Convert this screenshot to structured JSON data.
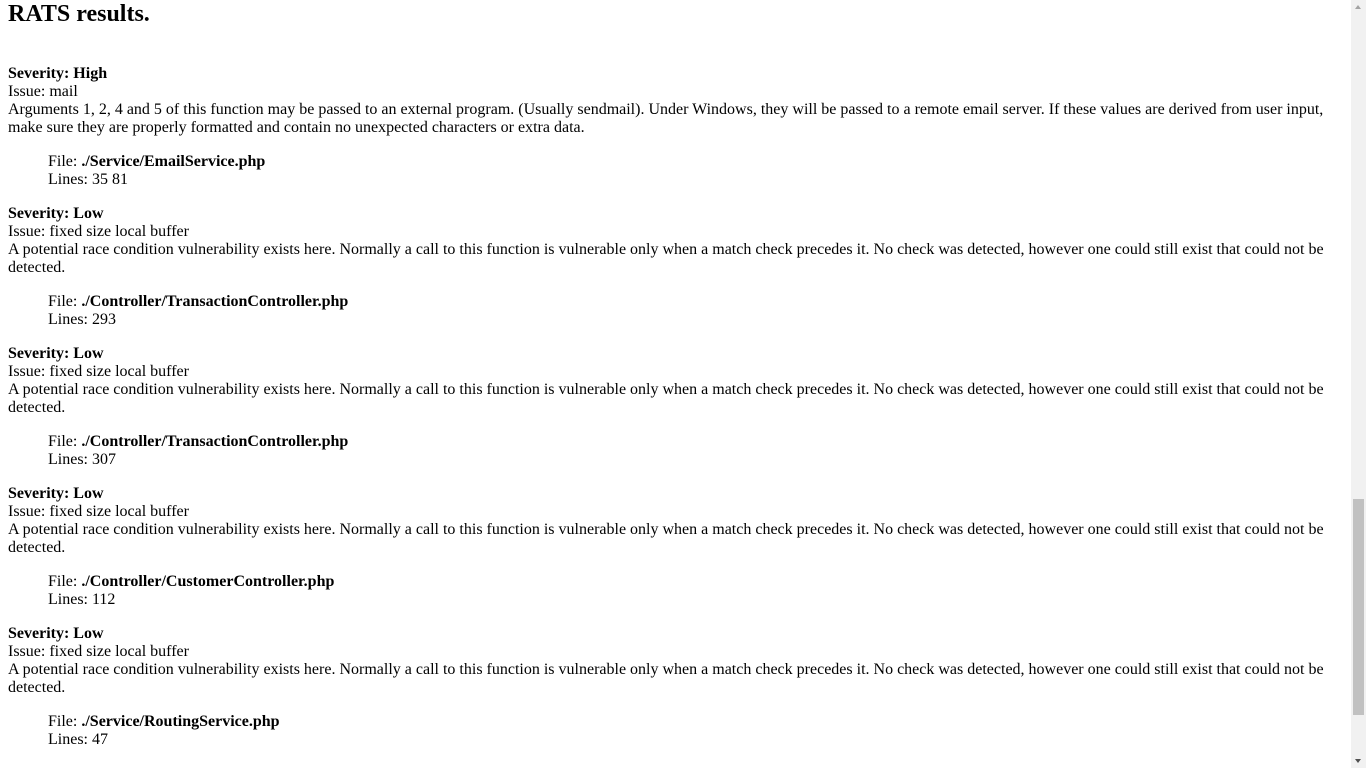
{
  "page": {
    "title": "RATS results."
  },
  "labels": {
    "severity_prefix": "Severity: ",
    "issue_prefix": "Issue: ",
    "file_prefix": "File: ",
    "lines_prefix": "Lines: "
  },
  "issues": [
    {
      "severity": "Severity: High",
      "issue": "Issue: mail",
      "description": "Arguments 1, 2, 4 and 5 of this function may be passed to an external program. (Usually sendmail). Under Windows, they will be passed to a remote email server. If these values are derived from user input, make sure they are properly formatted and contain no unexpected characters or extra data.",
      "file_label": "File: ",
      "file": "./Service/EmailService.php",
      "lines": "Lines: 35 81"
    },
    {
      "severity": "Severity: Low",
      "issue": "Issue: fixed size local buffer",
      "description": "A potential race condition vulnerability exists here. Normally a call to this function is vulnerable only when a match check precedes it. No check was detected, however one could still exist that could not be detected.",
      "file_label": "File: ",
      "file": "./Controller/TransactionController.php",
      "lines": "Lines: 293"
    },
    {
      "severity": "Severity: Low",
      "issue": "Issue: fixed size local buffer",
      "description": "A potential race condition vulnerability exists here. Normally a call to this function is vulnerable only when a match check precedes it. No check was detected, however one could still exist that could not be detected.",
      "file_label": "File: ",
      "file": "./Controller/TransactionController.php",
      "lines": "Lines: 307"
    },
    {
      "severity": "Severity: Low",
      "issue": "Issue: fixed size local buffer",
      "description": "A potential race condition vulnerability exists here. Normally a call to this function is vulnerable only when a match check precedes it. No check was detected, however one could still exist that could not be detected.",
      "file_label": "File: ",
      "file": "./Controller/CustomerController.php",
      "lines": "Lines: 112"
    },
    {
      "severity": "Severity: Low",
      "issue": "Issue: fixed size local buffer",
      "description": "A potential race condition vulnerability exists here. Normally a call to this function is vulnerable only when a match check precedes it. No check was detected, however one could still exist that could not be detected.",
      "file_label": "File: ",
      "file": "./Service/RoutingService.php",
      "lines": "Lines: 47"
    }
  ],
  "scrollbar": {
    "position_fraction": 0.65,
    "visible_fraction": 0.29
  }
}
